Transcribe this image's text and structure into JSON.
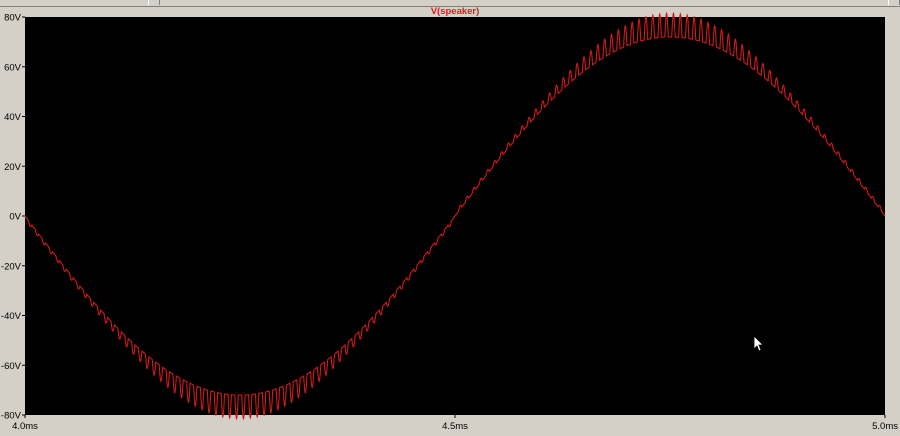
{
  "window": {
    "title": ""
  },
  "colors": {
    "chrome": "#d4d0c8",
    "plot_background": "#000000",
    "trace": "#d11a1a",
    "axis_text": "#000000"
  },
  "cursor": {
    "icon": "arrow-cursor-icon"
  },
  "chart_data": {
    "type": "line",
    "title": "V(speaker)",
    "xlabel": "",
    "ylabel": "",
    "xlim_ms": [
      4.0,
      5.0
    ],
    "ylim_V": [
      -80,
      80
    ],
    "grid": false,
    "y_ticks": [
      {
        "value": 80,
        "label": "80V"
      },
      {
        "value": 60,
        "label": "60V"
      },
      {
        "value": 40,
        "label": "40V"
      },
      {
        "value": 20,
        "label": "20V"
      },
      {
        "value": 0,
        "label": "0V"
      },
      {
        "value": -20,
        "label": "-20V"
      },
      {
        "value": -40,
        "label": "-40V"
      },
      {
        "value": -60,
        "label": "-60V"
      },
      {
        "value": -80,
        "label": "-80V"
      }
    ],
    "x_ticks": [
      {
        "value": 4.0,
        "label": "4.0ms"
      },
      {
        "value": 4.5,
        "label": "4.5ms"
      },
      {
        "value": 5.0,
        "label": "5.0ms"
      }
    ],
    "series": [
      {
        "name": "V(speaker)",
        "color": "#d11a1a",
        "description_points": {
          "x_ms": [
            4.0,
            4.05,
            4.1,
            4.15,
            4.2,
            4.25,
            4.3,
            4.35,
            4.4,
            4.45,
            4.5,
            4.55,
            4.6,
            4.65,
            4.7,
            4.75,
            4.8,
            4.85,
            4.9,
            4.95,
            5.0
          ],
          "y_V": [
            1,
            -22,
            -43,
            -59,
            -70,
            -74,
            -70,
            -59,
            -43,
            -22,
            0,
            22,
            43,
            59,
            70,
            74,
            70,
            59,
            43,
            22,
            1
          ]
        },
        "peak_V": 72,
        "ripple_V": 8,
        "ripple_cycles_per_ms": 125
      }
    ]
  }
}
